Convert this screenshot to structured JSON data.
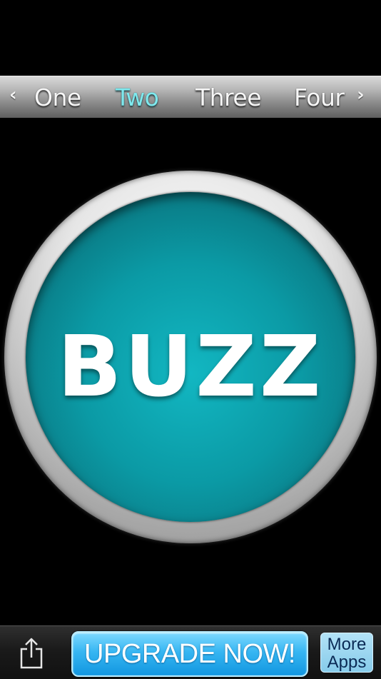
{
  "tabbar": {
    "left_arrow": "‹",
    "right_arrow": "›",
    "tabs": [
      {
        "label": "One"
      },
      {
        "label": "Two"
      },
      {
        "label": "Three"
      },
      {
        "label": "Four"
      }
    ],
    "active_tab": "Two",
    "active_color": "#7fe9ee"
  },
  "buzzer": {
    "label": "BUZZ",
    "color": "#0b9aa5"
  },
  "bottombar": {
    "share_icon": "share-icon",
    "upgrade_label": "UPGRADE NOW!",
    "more_line1": "More",
    "more_line2": "Apps"
  }
}
